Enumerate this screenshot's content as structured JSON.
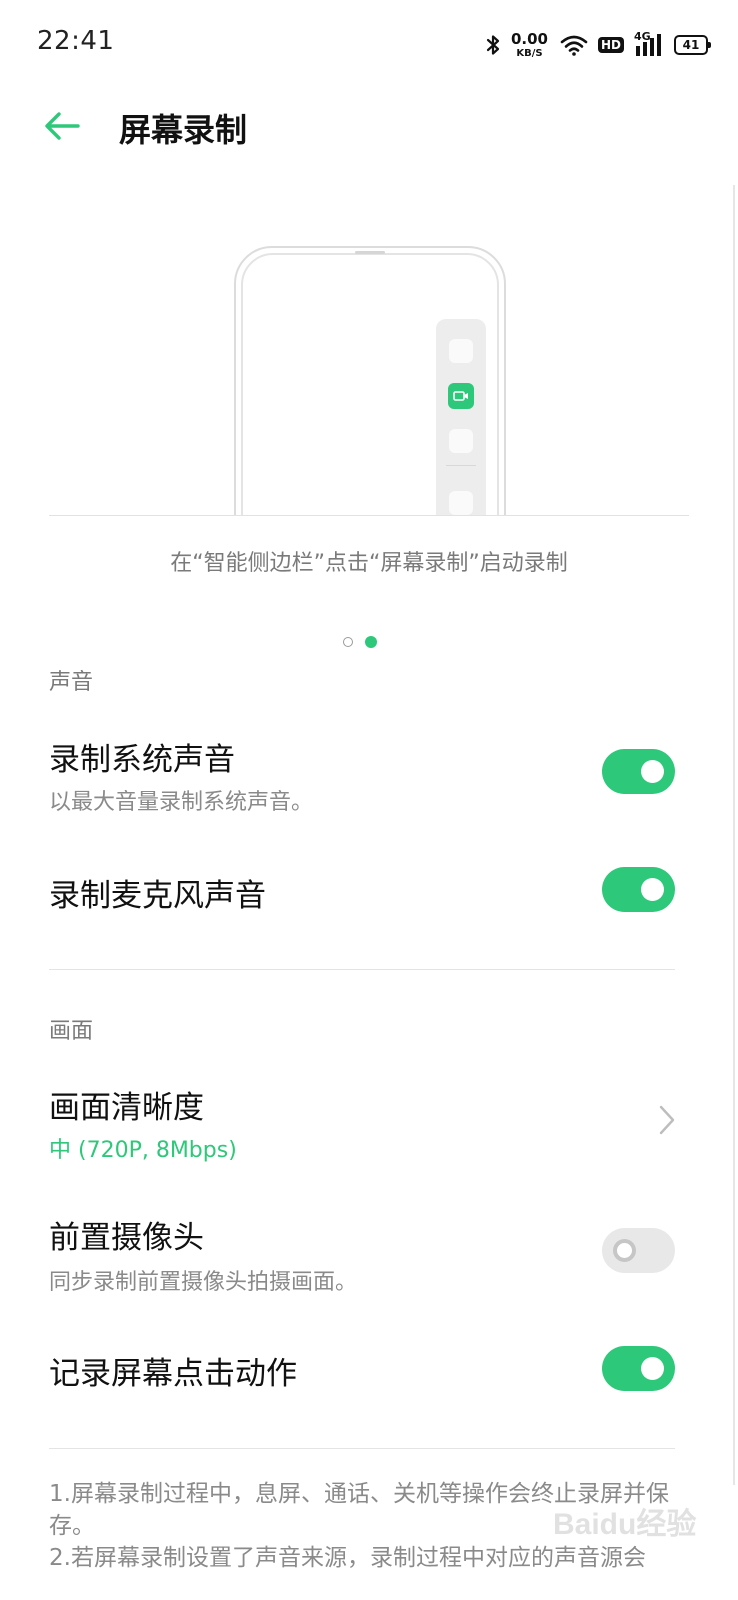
{
  "status_bar": {
    "time": "22:41",
    "net_speed_value": "0.00",
    "net_speed_unit": "KB/S",
    "hd_label": "HD",
    "network_label": "4G",
    "battery_level": "41",
    "icons": [
      "bluetooth-icon",
      "wifi-icon",
      "hd-icon",
      "signal-icon",
      "battery-icon"
    ]
  },
  "header": {
    "back_icon": "arrow-left-icon",
    "title": "屏幕录制"
  },
  "carousel": {
    "caption": "在“智能侧边栏”点击“屏幕录制”启动录制",
    "page_count": 2,
    "active_page": 2
  },
  "sections": {
    "sound": {
      "header": "声音",
      "items": [
        {
          "title": "录制系统声音",
          "subtitle": "以最大音量录制系统声音。",
          "enabled": true
        },
        {
          "title": "录制麦克风声音",
          "enabled": true
        }
      ]
    },
    "picture": {
      "header": "画面",
      "items": [
        {
          "title": "画面清晰度",
          "value": "中 (720P, 8Mbps)"
        },
        {
          "title": "前置摄像头",
          "subtitle": "同步录制前置摄像头拍摄画面。",
          "enabled": false
        },
        {
          "title": "记录屏幕点击动作",
          "enabled": true
        }
      ]
    }
  },
  "notes": [
    "1.屏幕录制过程中，息屏、通话、关机等操作会终止录屏并保存。",
    "2.若屏幕录制设置了声音来源，录制过程中对应的声音源会"
  ],
  "watermark": "Baidu经验",
  "colors": {
    "accent": "#2dc87a",
    "text_primary": "#111111",
    "text_secondary": "#8a8a8a",
    "switch_off": "#e8e8e8"
  }
}
